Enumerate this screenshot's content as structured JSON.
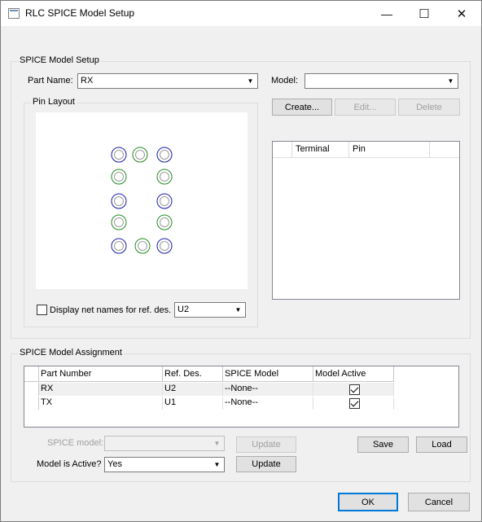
{
  "window": {
    "title": "RLC SPICE Model Setup",
    "minimize": "—",
    "maximize": "☐",
    "close": "✕"
  },
  "setup": {
    "legend": "SPICE Model Setup",
    "part_name_label": "Part Name:",
    "part_name_value": "RX",
    "model_label": "Model:",
    "model_value": "",
    "pin_layout_legend": "Pin Layout",
    "create_button": "Create...",
    "edit_button": "Edit...",
    "delete_button": "Delete",
    "terminal_table": {
      "columns": [
        "Terminal",
        "Pin",
        ""
      ]
    },
    "display_net_names_label": "Display net names for ref. des.",
    "display_net_names_checked": false,
    "ref_des_value": "U2",
    "pins": [
      {
        "color": "#1a1aa6"
      },
      {
        "color": "#1f8a1f"
      },
      {
        "color": "#1a1aa6"
      },
      {
        "color": "#1f8a1f"
      },
      {
        "color": "#1f8a1f"
      },
      {
        "color": "#1a1aa6"
      },
      {
        "color": "#1a1aa6"
      },
      {
        "color": "#1f8a1f"
      },
      {
        "color": "#1f8a1f"
      },
      {
        "color": "#1a1aa6"
      },
      {
        "color": "#1f8a1f"
      },
      {
        "color": "#1a1aa6"
      }
    ]
  },
  "assignment": {
    "legend": "SPICE Model Assignment",
    "columns": [
      "Part Number",
      "Ref. Des.",
      "SPICE Model",
      "Model Active"
    ],
    "rows": [
      {
        "part": "RX",
        "ref": "U2",
        "model": "--None--",
        "active": true
      },
      {
        "part": "TX",
        "ref": "U1",
        "model": "--None--",
        "active": true
      }
    ],
    "spice_model_label": "SPICE model:",
    "spice_model_value": "",
    "update_disabled_label": "Update",
    "model_active_label": "Model is Active?",
    "model_active_value": "Yes",
    "update_label": "Update",
    "save_label": "Save",
    "load_label": "Load"
  },
  "footer": {
    "ok_label": "OK",
    "cancel_label": "Cancel"
  },
  "colors": {
    "accent": "#0078d7",
    "pin_blue": "#1a1aa6",
    "pin_green": "#1f8a1f"
  }
}
